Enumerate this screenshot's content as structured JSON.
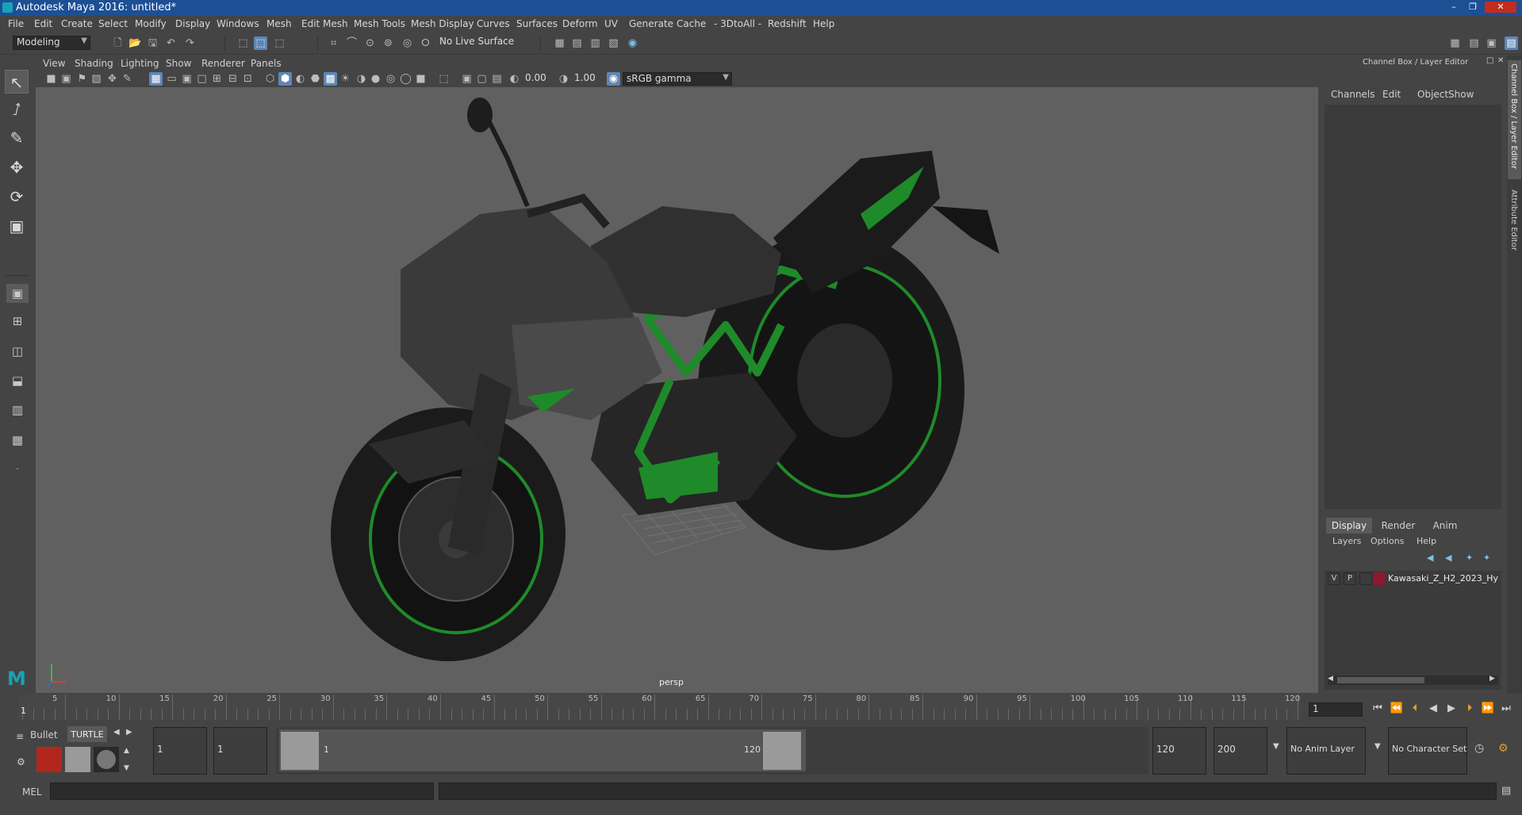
{
  "window": {
    "title": "Autodesk Maya 2016: untitled*"
  },
  "menubar": [
    "File",
    "Edit",
    "Create",
    "Select",
    "Modify",
    "Display",
    "Windows",
    "Mesh",
    "Edit Mesh",
    "Mesh Tools",
    "Mesh Display",
    "Curves",
    "Surfaces",
    "Deform",
    "UV",
    "Generate",
    "Cache",
    "- 3DtoAll -",
    "Redshift",
    "Help"
  ],
  "statusline": {
    "mode": "Modeling",
    "live_surface": "No Live Surface"
  },
  "viewport": {
    "menus": [
      "View",
      "Shading",
      "Lighting",
      "Show",
      "Renderer",
      "Panels"
    ],
    "exposure": "0.00",
    "gamma": "1.00",
    "color_space": "sRGB gamma",
    "camera_label": "persp"
  },
  "channel_box": {
    "title": "Channel Box / Layer Editor",
    "menus": [
      "Channels",
      "Edit",
      "Object",
      "Show"
    ]
  },
  "layer_editor": {
    "tabs": [
      "Display",
      "Render",
      "Anim"
    ],
    "active_tab": "Display",
    "menus": [
      "Layers",
      "Options",
      "Help"
    ],
    "layer": {
      "v": "V",
      "p": "P",
      "name": "Kawasaki_Z_H2_2023_Hy",
      "color": "#8c1a2e"
    }
  },
  "side_tabs": [
    "Channel Box / Layer Editor",
    "Attribute Editor"
  ],
  "timeline": {
    "ticks": [
      "5",
      "10",
      "15",
      "20",
      "25",
      "30",
      "35",
      "40",
      "45",
      "50",
      "55",
      "60",
      "65",
      "70",
      "75",
      "80",
      "85",
      "90",
      "95",
      "100",
      "105",
      "110",
      "115",
      "120"
    ],
    "current_marker": "1",
    "current_frame": "1"
  },
  "range": {
    "start": "1",
    "playback_start": "1",
    "slider_start": "1",
    "slider_end": "120",
    "playback_end": "120",
    "end": "200",
    "anim_layer": "No Anim Layer",
    "character_set": "No Character Set"
  },
  "shelf": {
    "tabs": [
      "Bullet",
      "TURTLE"
    ]
  },
  "cmdline": {
    "label": "MEL"
  },
  "colors": {
    "accent": "#5d86b4",
    "titlebar": "#1c4f94",
    "bike_green": "#1f8a2a"
  }
}
